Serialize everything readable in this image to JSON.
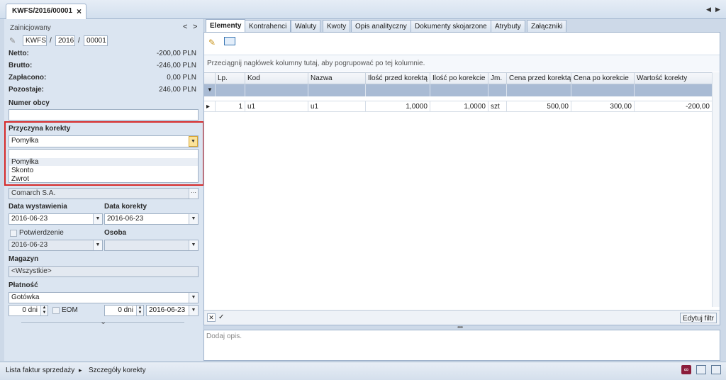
{
  "doc_tab": {
    "title": "KWFS/2016/00001",
    "close": "×"
  },
  "nav": {
    "left": "◀",
    "right": "▶"
  },
  "left": {
    "status": "Zainicjowany",
    "prev": "<",
    "next": ">",
    "number": {
      "prefix": "KWFS",
      "sep1": "/",
      "year": "2016",
      "sep2": "/",
      "seq": "00001"
    },
    "netto": {
      "label": "Netto:",
      "value": "-200,00 PLN"
    },
    "brutto": {
      "label": "Brutto:",
      "value": "-246,00 PLN"
    },
    "zaplacono": {
      "label": "Zapłacono:",
      "value": "0,00 PLN"
    },
    "pozostaje": {
      "label": "Pozostaje:",
      "value": "246,00 PLN"
    },
    "numer_obcy": {
      "label": "Numer obcy",
      "value": ""
    },
    "przyczyna": {
      "label": "Przyczyna korekty",
      "value": "Pomyłka",
      "options": [
        "Pomyłka",
        "Skonto",
        "Zwrot"
      ]
    },
    "kontrahent": {
      "value": "Comarch S.A.",
      "btn": "···"
    },
    "data_wystawienia": {
      "label": "Data wystawienia",
      "value": "2016-06-23"
    },
    "data_korekty": {
      "label": "Data korekty",
      "value": "2016-06-23"
    },
    "potwierdzenie": {
      "label": "Potwierdzenie",
      "value": "2016-06-23"
    },
    "osoba": {
      "label": "Osoba",
      "value": ""
    },
    "magazyn": {
      "label": "Magazyn",
      "value": "<Wszystkie>"
    },
    "platnosc": {
      "label": "Płatność",
      "value": "Gotówka"
    },
    "termin1": {
      "value": "0 dni"
    },
    "eom": {
      "label": "EOM"
    },
    "termin2": {
      "value": "0 dni"
    },
    "termin_data": {
      "value": "2016-06-23"
    },
    "expand": "⌄"
  },
  "tabs": [
    "Elementy",
    "Kontrahenci",
    "Waluty",
    "Kwoty",
    "Opis analityczny",
    "Dokumenty skojarzone",
    "Atrybuty",
    "Załączniki"
  ],
  "grid": {
    "group_hint": "Przeciągnij nagłówek kolumny tutaj, aby pogrupować po tej kolumnie.",
    "columns": [
      "Lp.",
      "Kod",
      "Nazwa",
      "Ilość przed korektą",
      "Ilość po korekcie",
      "Jm.",
      "Cena przed korektą",
      "Cena po korekcie",
      "Wartość korekty"
    ],
    "rows": [
      {
        "lp": "1",
        "kod": "u1",
        "nazwa": "u1",
        "ilosc_przed": "1,0000",
        "ilosc_po": "1,0000",
        "jm": "szt",
        "cena_przed": "500,00",
        "cena_po": "300,00",
        "wartosc": "-200,00"
      }
    ],
    "edit_filter": "Edytuj filtr",
    "row_marker": "▸",
    "filter_marker": "▼"
  },
  "description_placeholder": "Dodaj opis.",
  "statusbar": {
    "crumb1": "Lista faktur sprzedaży",
    "sep": "▸",
    "crumb2": "Szczegóły korekty"
  },
  "colors": {
    "highlight": "#d62a2a",
    "accent": "#a9bbd4"
  }
}
